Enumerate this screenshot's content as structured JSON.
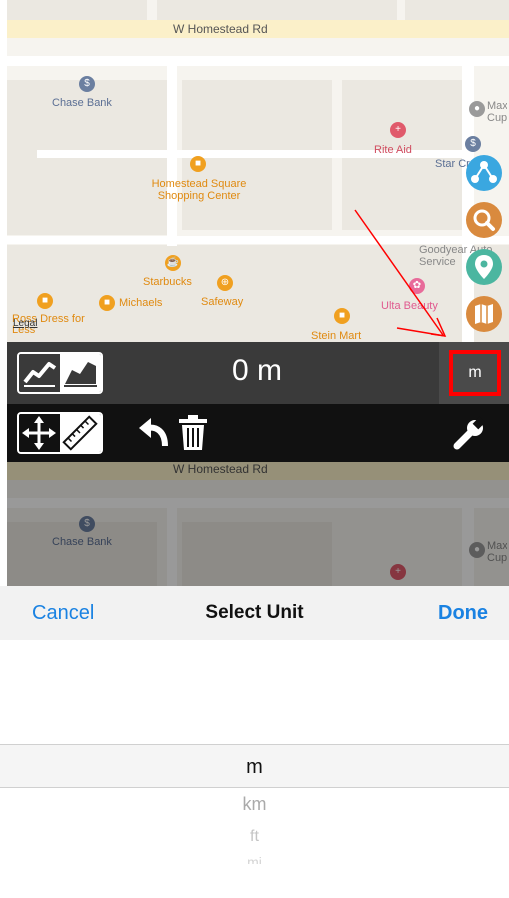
{
  "map_top": {
    "street_label": "W Homestead Rd",
    "pois": [
      {
        "name": "Chase Bank"
      },
      {
        "name": "Rite Aid"
      },
      {
        "name": "Homestead Square Shopping Center"
      },
      {
        "name": "Max Cup"
      },
      {
        "name": "Star Credi"
      },
      {
        "name": "Goodyear Auto Service"
      },
      {
        "name": "Starbucks"
      },
      {
        "name": "Safeway"
      },
      {
        "name": "Michaels"
      },
      {
        "name": "Ross Dress for Less"
      },
      {
        "name": "Ulta Beauty"
      },
      {
        "name": "Stein Mart"
      }
    ],
    "legal": "Legal"
  },
  "measure_bar": {
    "distance": "0 m",
    "unit_button": "m"
  },
  "map_bottom": {
    "street_label": "W Homestead Rd",
    "pois": [
      {
        "name": "Chase Bank"
      },
      {
        "name": "Max Cup"
      }
    ]
  },
  "sheet": {
    "cancel": "Cancel",
    "title": "Select Unit",
    "done": "Done",
    "options": [
      "m",
      "km",
      "ft",
      "mi"
    ],
    "selected": "m"
  },
  "colors": {
    "accent": "#1a82e2",
    "highlight": "#ff0000",
    "bar_bg": "#3a3a3a",
    "toolbar_bg": "#111111"
  }
}
